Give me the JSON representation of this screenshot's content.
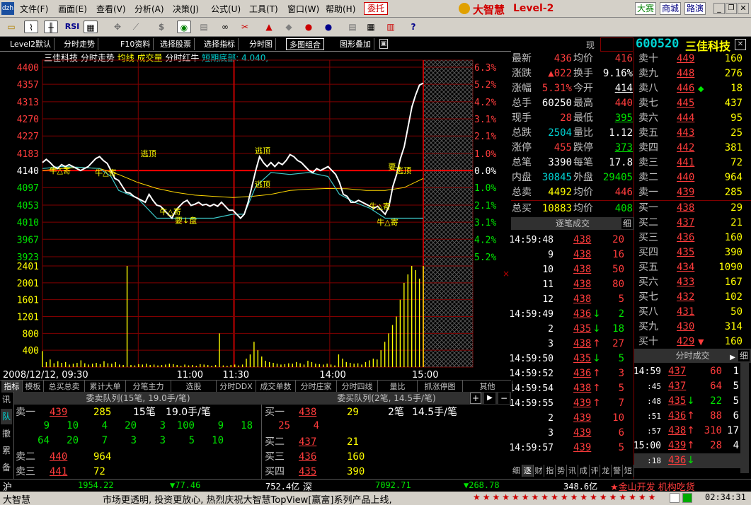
{
  "menu": {
    "items": [
      "文件(F)",
      "画面(E)",
      "查看(V)",
      "分析(A)",
      "决策(J)",
      "公式(U)",
      "工具(T)",
      "窗口(W)",
      "帮助(H)"
    ],
    "order_btn": "委托",
    "brand": "大智慧",
    "brand_suffix": "Level-2",
    "right_btns": [
      "大赛",
      "商城",
      "路演"
    ]
  },
  "toolbar": {
    "icons": [
      "open-icon",
      "chart-icon",
      "kline-icon",
      "rsi-icon",
      "grid-icon",
      "move-icon",
      "ruler-icon",
      "dollar-icon",
      "eye-icon",
      "stripes-icon",
      "binoculars-icon",
      "cut-icon",
      "alert-icon",
      "diamond-icon",
      "lips-icon",
      "circle-icon",
      "doc-icon",
      "table-icon",
      "books-icon",
      "help-icon"
    ],
    "rsi_label": "RSI"
  },
  "tabs": [
    "Level2默认",
    "分时走势",
    "F10资料",
    "选择股票",
    "选择指标",
    "分时图",
    "多图组合",
    "图形叠加"
  ],
  "stock": {
    "code": "600520",
    "name": "三佳科技",
    "xian": "现"
  },
  "chart_header": {
    "name": "三佳科技",
    "items": [
      "分时走势",
      "均线",
      "成交量",
      "分时红牛"
    ],
    "extra": "短期底部: 4.040,"
  },
  "chart_data": {
    "type": "line",
    "price_ticks": [
      "4400",
      "4357",
      "4313",
      "4270",
      "4227",
      "4183",
      "4140",
      "4097",
      "4053",
      "4010",
      "3967",
      "3923"
    ],
    "pct_ticks": [
      "6.3%",
      "5.2%",
      "4.2%",
      "3.1%",
      "2.1%",
      "1.0%",
      "0.0%",
      "1.0%",
      "2.1%",
      "3.1%",
      "4.2%",
      "5.2%"
    ],
    "vol_ticks": [
      "2401",
      "2001",
      "1601",
      "1201",
      "800",
      "400"
    ],
    "x_labels": [
      "2008/12/12, 09:30",
      "11:00",
      "11:30",
      "14:00",
      "15:00"
    ],
    "prev_close": 4140,
    "ylim": [
      3923,
      4400
    ],
    "annotations": [
      {
        "text": "逃顶",
        "t": 0.28,
        "v": 4183
      },
      {
        "text": "逃顶",
        "t": 0.58,
        "v": 4190
      },
      {
        "text": "逃顶",
        "t": 0.58,
        "v": 4105
      },
      {
        "text": "要↓盘",
        "t": 0.37,
        "v": 4015
      },
      {
        "text": "牛△寄",
        "t": 0.04,
        "v": 4140
      },
      {
        "text": "牛△寄",
        "t": 0.16,
        "v": 4135
      },
      {
        "text": "牛△寄",
        "t": 0.33,
        "v": 4037
      },
      {
        "text": "牛△寄",
        "t": 0.88,
        "v": 4050
      },
      {
        "text": "牛△寄",
        "t": 0.9,
        "v": 4010
      },
      {
        "text": "要↓",
        "t": 0.93,
        "v": 4150
      },
      {
        "text": "逃顶",
        "t": 0.95,
        "v": 4140
      }
    ],
    "price_series": [
      [
        0,
        4160
      ],
      [
        0.01,
        4168
      ],
      [
        0.02,
        4160
      ],
      [
        0.03,
        4150
      ],
      [
        0.04,
        4145
      ],
      [
        0.05,
        4155
      ],
      [
        0.06,
        4150
      ],
      [
        0.07,
        4155
      ],
      [
        0.08,
        4150
      ],
      [
        0.09,
        4145
      ],
      [
        0.1,
        4140
      ],
      [
        0.12,
        4150
      ],
      [
        0.13,
        4160
      ],
      [
        0.14,
        4170
      ],
      [
        0.15,
        4175
      ],
      [
        0.16,
        4165
      ],
      [
        0.17,
        4158
      ],
      [
        0.18,
        4140
      ],
      [
        0.19,
        4120
      ],
      [
        0.2,
        4115
      ],
      [
        0.21,
        4100
      ],
      [
        0.22,
        4085
      ],
      [
        0.23,
        4083
      ],
      [
        0.24,
        4075
      ],
      [
        0.25,
        4070
      ],
      [
        0.26,
        4065
      ],
      [
        0.27,
        4060
      ],
      [
        0.28,
        4080
      ],
      [
        0.29,
        4065
      ],
      [
        0.3,
        4053
      ],
      [
        0.31,
        4050
      ],
      [
        0.32,
        4040
      ],
      [
        0.33,
        4030
      ],
      [
        0.34,
        4020
      ],
      [
        0.35,
        4040
      ],
      [
        0.36,
        4050
      ],
      [
        0.37,
        4060
      ],
      [
        0.38,
        4065
      ],
      [
        0.39,
        4052
      ],
      [
        0.4,
        4055
      ],
      [
        0.41,
        4060
      ],
      [
        0.42,
        4053
      ],
      [
        0.43,
        4055
      ],
      [
        0.44,
        4050
      ],
      [
        0.45,
        4055
      ],
      [
        0.46,
        4050
      ],
      [
        0.47,
        4060
      ],
      [
        0.48,
        4050
      ],
      [
        0.49,
        4040
      ],
      [
        0.5,
        4040
      ],
      [
        0.51,
        4030
      ],
      [
        0.52,
        4020
      ],
      [
        0.53,
        4030
      ],
      [
        0.54,
        4060
      ],
      [
        0.55,
        4100
      ],
      [
        0.56,
        4140
      ],
      [
        0.57,
        4175
      ],
      [
        0.58,
        4160
      ],
      [
        0.59,
        4150
      ],
      [
        0.6,
        4160
      ],
      [
        0.61,
        4150
      ],
      [
        0.62,
        4160
      ],
      [
        0.63,
        4155
      ],
      [
        0.64,
        4165
      ],
      [
        0.65,
        4180
      ],
      [
        0.66,
        4175
      ],
      [
        0.67,
        4165
      ],
      [
        0.68,
        4160
      ],
      [
        0.69,
        4150
      ],
      [
        0.7,
        4140
      ],
      [
        0.71,
        4135
      ],
      [
        0.72,
        4145
      ],
      [
        0.73,
        4140
      ],
      [
        0.74,
        4145
      ],
      [
        0.75,
        4150
      ],
      [
        0.76,
        4140
      ],
      [
        0.77,
        4130
      ],
      [
        0.78,
        4110
      ],
      [
        0.79,
        4080
      ],
      [
        0.8,
        4075
      ],
      [
        0.81,
        4060
      ],
      [
        0.82,
        4060
      ],
      [
        0.83,
        4065
      ],
      [
        0.84,
        4060
      ],
      [
        0.85,
        4055
      ],
      [
        0.86,
        4050
      ],
      [
        0.87,
        4045
      ],
      [
        0.88,
        4050
      ],
      [
        0.89,
        4040
      ],
      [
        0.9,
        4030
      ],
      [
        0.91,
        4050
      ],
      [
        0.92,
        4100
      ],
      [
        0.93,
        4130
      ],
      [
        0.94,
        4170
      ],
      [
        0.95,
        4200
      ],
      [
        0.96,
        4250
      ],
      [
        0.97,
        4300
      ],
      [
        0.98,
        4330
      ],
      [
        0.99,
        4355
      ],
      [
        1.0,
        4360
      ]
    ],
    "avg_series": [
      [
        0,
        4140
      ],
      [
        0.05,
        4145
      ],
      [
        0.1,
        4148
      ],
      [
        0.15,
        4145
      ],
      [
        0.2,
        4130
      ],
      [
        0.25,
        4110
      ],
      [
        0.3,
        4095
      ],
      [
        0.35,
        4085
      ],
      [
        0.4,
        4078
      ],
      [
        0.45,
        4075
      ],
      [
        0.5,
        4072
      ],
      [
        0.55,
        4075
      ],
      [
        0.6,
        4080
      ],
      [
        0.65,
        4090
      ],
      [
        0.7,
        4093
      ],
      [
        0.75,
        4095
      ],
      [
        0.8,
        4094
      ],
      [
        0.85,
        4090
      ],
      [
        0.9,
        4090
      ],
      [
        0.95,
        4097
      ],
      [
        1.0,
        4120
      ]
    ],
    "cyan_series": [
      [
        0,
        4145
      ],
      [
        0.05,
        4150
      ],
      [
        0.1,
        4148
      ],
      [
        0.15,
        4145
      ],
      [
        0.18,
        4125
      ],
      [
        0.2,
        4090
      ],
      [
        0.25,
        4070
      ],
      [
        0.3,
        4020
      ],
      [
        0.35,
        4020
      ],
      [
        0.4,
        4020
      ],
      [
        0.45,
        4020
      ],
      [
        0.5,
        4030
      ],
      [
        0.53,
        4030
      ],
      [
        0.56,
        4100
      ],
      [
        0.6,
        4135
      ],
      [
        0.65,
        4130
      ],
      [
        0.7,
        4135
      ],
      [
        0.75,
        4125
      ],
      [
        0.78,
        4080
      ],
      [
        0.82,
        4060
      ],
      [
        0.86,
        4045
      ],
      [
        0.9,
        4020
      ],
      [
        0.95,
        4020
      ],
      [
        1.0,
        4020
      ]
    ],
    "volume": [
      380,
      120,
      180,
      90,
      140,
      100,
      120,
      60,
      80,
      100,
      160,
      90,
      60,
      80,
      100,
      70,
      140,
      90,
      80,
      120,
      60,
      50,
      2401,
      50,
      40,
      70,
      60,
      80,
      50,
      60,
      40,
      50,
      60,
      80,
      70,
      50,
      30,
      60,
      40,
      50,
      30,
      70,
      60,
      50,
      30,
      50,
      800,
      40,
      30,
      50,
      60,
      40,
      60,
      200,
      300,
      600,
      400,
      250,
      150,
      120,
      100,
      80,
      60,
      70,
      90,
      80,
      120,
      90,
      60,
      150,
      120,
      80,
      70,
      60,
      80,
      60,
      40,
      300,
      200,
      120,
      100,
      80,
      90,
      60,
      120,
      160,
      200,
      180,
      400,
      600,
      800,
      1000,
      1200,
      1600,
      2000,
      2200,
      2400,
      2300,
      2100,
      2401
    ]
  },
  "quote": {
    "rows": [
      {
        "l1": "最新",
        "v1": "436",
        "l2": "均价",
        "v2": "416"
      },
      {
        "l1": "涨跌",
        "v1": "▲022",
        "l2": "换手",
        "v2": "9.16%"
      },
      {
        "l1": "涨幅",
        "v1": "5.31%",
        "l2": "今开",
        "v2": "414"
      },
      {
        "l1": "总手",
        "v1": "60250",
        "l2": "最高",
        "v2": "440"
      },
      {
        "l1": "现手",
        "v1": "28",
        "l2": "最低",
        "v2": "395"
      },
      {
        "l1": "总跌",
        "v1": "2504",
        "l2": "量比",
        "v2": "1.12"
      },
      {
        "l1": "涨停",
        "v1": "455",
        "l2": "跌停",
        "v2": "373"
      },
      {
        "l1": "总笔",
        "v1": "3390",
        "l2": "每笔",
        "v2": "17.8"
      },
      {
        "l1": "内盘",
        "v1": "30845",
        "l2": "外盘",
        "v2": "29405"
      },
      {
        "l1": "总卖",
        "v1": "4492",
        "l2": "均价",
        "v2": "446"
      },
      {
        "l1": "总买",
        "v1": "10883",
        "l2": "均价",
        "v2": "408"
      }
    ]
  },
  "order_book": {
    "sells": [
      {
        "label": "卖十",
        "price": "449",
        "vol": "160"
      },
      {
        "label": "卖九",
        "price": "448",
        "vol": "276"
      },
      {
        "label": "卖八",
        "price": "446",
        "vol": "18",
        "mark": "◆"
      },
      {
        "label": "卖七",
        "price": "445",
        "vol": "437"
      },
      {
        "label": "卖六",
        "price": "444",
        "vol": "95"
      },
      {
        "label": "卖五",
        "price": "443",
        "vol": "25"
      },
      {
        "label": "卖四",
        "price": "442",
        "vol": "381"
      },
      {
        "label": "卖三",
        "price": "441",
        "vol": "72"
      },
      {
        "label": "卖二",
        "price": "440",
        "vol": "964"
      },
      {
        "label": "卖一",
        "price": "439",
        "vol": "285"
      }
    ],
    "buys": [
      {
        "label": "买一",
        "price": "438",
        "vol": "29"
      },
      {
        "label": "买二",
        "price": "437",
        "vol": "21"
      },
      {
        "label": "买三",
        "price": "436",
        "vol": "160"
      },
      {
        "label": "买四",
        "price": "435",
        "vol": "390"
      },
      {
        "label": "买五",
        "price": "434",
        "vol": "1090"
      },
      {
        "label": "买六",
        "price": "433",
        "vol": "167"
      },
      {
        "label": "买七",
        "price": "432",
        "vol": "102"
      },
      {
        "label": "买八",
        "price": "431",
        "vol": "50"
      },
      {
        "label": "买九",
        "price": "430",
        "vol": "314"
      },
      {
        "label": "买十",
        "price": "429",
        "vol": "160",
        "mark": "▼"
      }
    ]
  },
  "tick_by_tick": {
    "title": "逐笔成交",
    "btn": "细",
    "rows": [
      {
        "t": "14:59:48",
        "p": "438",
        "v": "20",
        "arrow": ""
      },
      {
        "t": "9",
        "p": "438",
        "v": "16",
        "arrow": ""
      },
      {
        "t": "10",
        "p": "438",
        "v": "50",
        "arrow": ""
      },
      {
        "t": "11",
        "p": "438",
        "v": "80",
        "arrow": ""
      },
      {
        "t": "12",
        "p": "438",
        "v": "5",
        "arrow": ""
      },
      {
        "t": "14:59:49",
        "p": "436",
        "v": "2",
        "arrow": "↓"
      },
      {
        "t": "2",
        "p": "435",
        "v": "18",
        "arrow": "↓"
      },
      {
        "t": "3",
        "p": "438",
        "v": "27",
        "arrow": "↑"
      },
      {
        "t": "14:59:50",
        "p": "435",
        "v": "5",
        "arrow": "↓"
      },
      {
        "t": "14:59:52",
        "p": "436",
        "v": "3",
        "arrow": "↑"
      },
      {
        "t": "14:59:54",
        "p": "438",
        "v": "5",
        "arrow": "↑"
      },
      {
        "t": "14:59:55",
        "p": "439",
        "v": "7",
        "arrow": "↑"
      },
      {
        "t": "2",
        "p": "439",
        "v": "10",
        "arrow": ""
      },
      {
        "t": "3",
        "p": "439",
        "v": "6",
        "arrow": ""
      },
      {
        "t": "14:59:57",
        "p": "439",
        "v": "5",
        "arrow": ""
      }
    ],
    "bottom_tabs": [
      "细",
      "逐",
      "财",
      "指",
      "势",
      "讯",
      "成",
      "评",
      "龙",
      "警",
      "短"
    ]
  },
  "minute_trades": {
    "title": "分时成交",
    "btn": "细",
    "rows": [
      {
        "t": "14:59",
        "p": "437",
        "v": "60",
        "n": "1",
        "arrow": ""
      },
      {
        "t": ":45",
        "p": "437",
        "v": "64",
        "n": "5",
        "arrow": ""
      },
      {
        "t": ":48",
        "p": "435",
        "v": "22",
        "n": "5",
        "arrow": "↓"
      },
      {
        "t": ":51",
        "p": "436",
        "v": "88",
        "n": "6",
        "arrow": "↑"
      },
      {
        "t": ":57",
        "p": "438",
        "v": "310",
        "n": "17",
        "arrow": "↑"
      },
      {
        "t": "15:00",
        "p": "439",
        "v": "28",
        "n": "4",
        "arrow": "↑"
      },
      {
        "t": ":18",
        "p": "436",
        "v": "",
        "n": "",
        "arrow": "↓"
      }
    ]
  },
  "bottom_tabs": [
    "指标",
    "模板",
    "总买总卖",
    "累计大单",
    "分笔主力",
    "选股",
    "分时DDX",
    "成交单数",
    "分时庄家",
    "分时四线",
    "量比",
    "抓涨停图",
    "其他"
  ],
  "side_tabs": [
    "讯",
    "队",
    "撤",
    "累",
    "备"
  ],
  "sell_queue": {
    "title": "委卖队列(15笔, 19.0手/笔)",
    "row1": {
      "label": "卖一",
      "price": "439",
      "vol": "285",
      "count": "15笔",
      "avg": "19.0手/笔"
    },
    "queue": [
      [
        "9",
        "10",
        "4",
        "20",
        "3",
        "100",
        "9",
        "18"
      ],
      [
        "64",
        "20",
        "7",
        "3",
        "3",
        "5",
        "10",
        ""
      ]
    ],
    "rows": [
      {
        "label": "卖二",
        "price": "440",
        "vol": "964"
      },
      {
        "label": "卖三",
        "price": "441",
        "vol": "72"
      }
    ]
  },
  "buy_queue": {
    "title": "委买队列(2笔, 14.5手/笔)",
    "row1": {
      "label": "买一",
      "price": "438",
      "vol": "29",
      "count": "2笔",
      "avg": "14.5手/笔"
    },
    "queue": [
      "25",
      "4"
    ],
    "rows": [
      {
        "label": "买二",
        "price": "437",
        "vol": "21"
      },
      {
        "label": "买三",
        "price": "436",
        "vol": "160"
      },
      {
        "label": "买四",
        "price": "435",
        "vol": "390"
      }
    ],
    "controls": [
      "+",
      "▶",
      "−"
    ]
  },
  "status": {
    "sh_label": "沪",
    "sh_index": "1954.22",
    "sh_change": "▼77.46",
    "sh_amount": "752.4亿",
    "sz_label": "深",
    "sz_index": "7092.71",
    "sz_change": "▼268.78",
    "sz_amount": "348.6亿",
    "news": "★金山开发 机构吃货"
  },
  "ticker": {
    "brand": "大智慧",
    "text": "市场更透明, 投资更放心, 热烈庆祝大智慧TopView[赢富]系列产品上线,",
    "time": "02:34:31"
  },
  "colors": {
    "up": "#ff3c3c",
    "down": "#00e600",
    "flat": "#ffffff",
    "grid": "#800000",
    "avg": "#ffd700",
    "cyan": "#3cc8c8"
  }
}
